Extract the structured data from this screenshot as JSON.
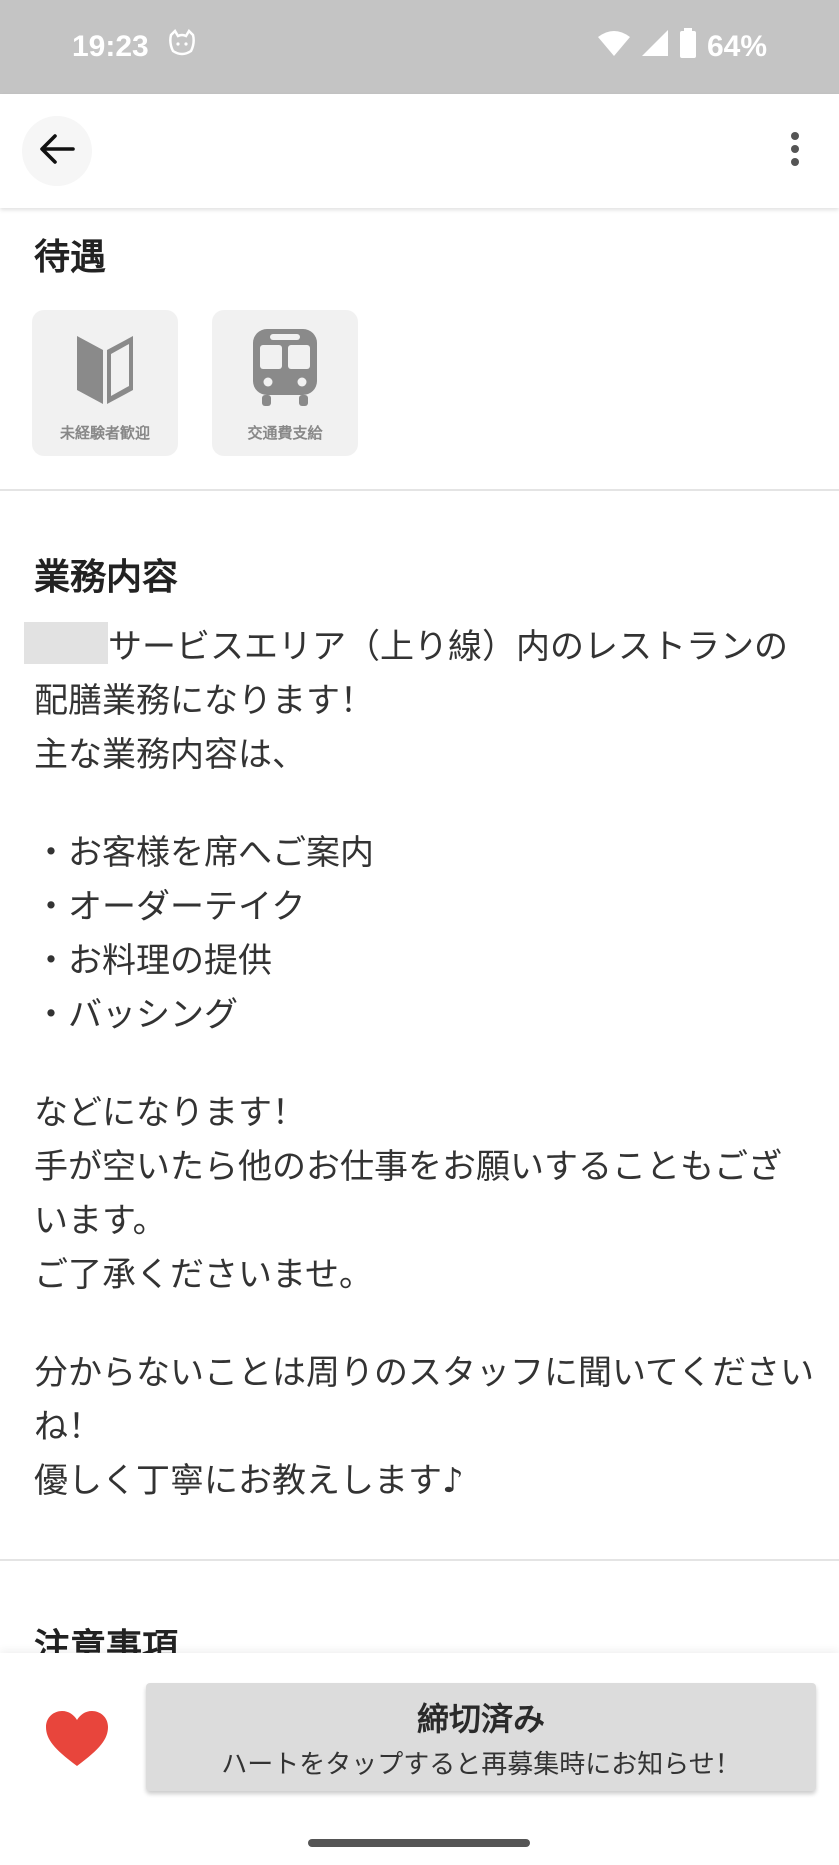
{
  "status_bar": {
    "time": "19:23",
    "battery": "64%",
    "icons": [
      "cat-notification-icon",
      "wifi-icon",
      "signal-icon",
      "battery-icon"
    ]
  },
  "app_bar": {
    "back_icon": "arrow-left-icon",
    "more_icon": "more-vertical-icon"
  },
  "benefits": {
    "title": "待遇",
    "items": [
      {
        "label": "未経験者歓迎",
        "icon": "beginner-mark-icon"
      },
      {
        "label": "交通費支給",
        "icon": "train-icon"
      }
    ]
  },
  "job_description": {
    "title": "業務内容",
    "paragraphs": [
      "サービスエリア（上り線）内のレストランの配膳業務になります！\n主な業務内容は、",
      "・お客様を席へご案内\n・オーダーテイク\n・お料理の提供\n・バッシング",
      "などになります！\n手が空いたら他のお仕事をお願いすることもございます。\nご了承くださいませ。",
      "分からないことは周りのスタッフに聞いてくださいね！\n優しく丁寧にお教えします♪"
    ]
  },
  "notes": {
    "title": "注意事項"
  },
  "bottom_bar": {
    "heart_icon": "heart-icon",
    "heart_color": "#e8453c",
    "button_main": "締切済み",
    "button_sub": "ハートをタップすると再募集時にお知らせ！"
  }
}
